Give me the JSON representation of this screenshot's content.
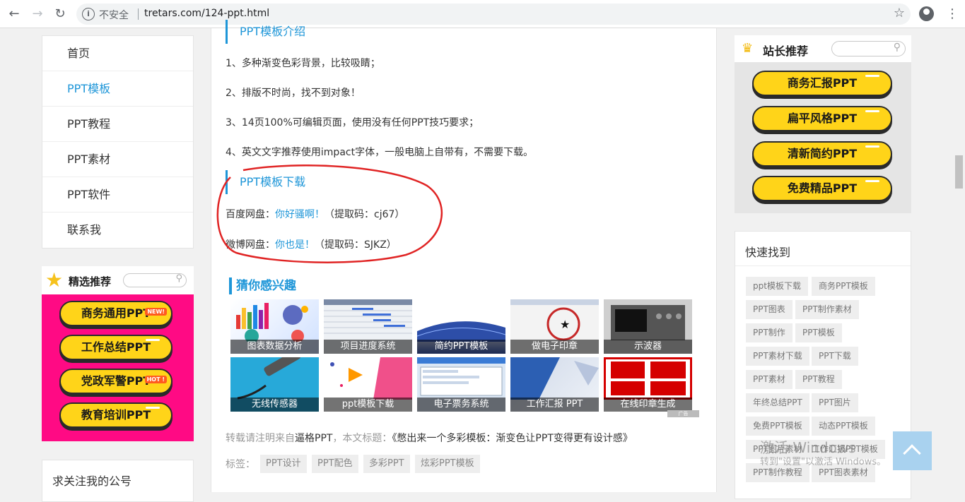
{
  "browser": {
    "insecure_label": "不安全",
    "url": "tretars.com/124-ppt.html"
  },
  "leftnav": {
    "items": [
      {
        "label": "首页"
      },
      {
        "label": "PPT模板"
      },
      {
        "label": "PPT教程"
      },
      {
        "label": "PPT素材"
      },
      {
        "label": "PPT软件"
      },
      {
        "label": "联系我"
      }
    ]
  },
  "featured": {
    "title": "精选推荐",
    "buttons": [
      {
        "label": "商务通用PPT",
        "tag": "NEW!"
      },
      {
        "label": "工作总结PPT",
        "tag": ""
      },
      {
        "label": "党政军警PPT",
        "tag": "HOT !"
      },
      {
        "label": "教育培训PPT",
        "tag": ""
      }
    ]
  },
  "qr": {
    "title": "求关注我的公号"
  },
  "article": {
    "intro_heading": "PPT模板介绍",
    "points": [
      "1、多种渐变色彩背景，比较吸睛；",
      "2、排版不时尚，找不到对象！",
      "3、14页100%可编辑页面，使用没有任何PPT技巧要求；",
      "4、英文文字推荐使用impact字体，一般电脑上自带有，不需要下载。"
    ],
    "download_heading": "PPT模板下载",
    "baidu": {
      "prefix": "百度网盘：",
      "link": "你好骚啊！",
      "code": "（提取码：cj67）"
    },
    "weibo": {
      "prefix": "微博网盘：",
      "link": "你也是！",
      "code": "（提取码：SJKZ）"
    },
    "guess_heading": "猜你感兴趣",
    "thumbs": [
      {
        "caption": "图表数据分析"
      },
      {
        "caption": "项目进度系统"
      },
      {
        "caption": "简约PPT模板"
      },
      {
        "caption": "做电子印章"
      },
      {
        "caption": "示波器"
      },
      {
        "caption": "无线传感器"
      },
      {
        "caption": "ppt模板下载"
      },
      {
        "caption": "电子票务系统"
      },
      {
        "caption": "工作汇报 PPT"
      },
      {
        "caption": "在线印章生成"
      }
    ],
    "ad_label": "广告",
    "repost_prefix": "转载请注明来自",
    "repost_site": "逼格PPT",
    "repost_mid": "，本文标题：",
    "repost_title": "《憋出来一个多彩模板：渐变色让PPT变得更有设计感》",
    "tags_label": "标签：",
    "tags": [
      "PPT设计",
      "PPT配色",
      "多彩PPT",
      "炫彩PPT模板"
    ]
  },
  "recommend": {
    "title": "站长推荐",
    "buttons": [
      {
        "label": "商务汇报PPT"
      },
      {
        "label": "扁平风格PPT"
      },
      {
        "label": "清新简约PPT"
      },
      {
        "label": "免费精品PPT"
      }
    ]
  },
  "quick": {
    "title": "快速找到",
    "chips": [
      "ppt模板下载",
      "商务PPT模板",
      "PPT图表",
      "PPT制作素材",
      "PPT制作",
      "PPT模板",
      "PPT素材下载",
      "PPT下载",
      "PPT素材",
      "PPT教程",
      "年终总结PPT",
      "PPT图片",
      "免费PPT模板",
      "动态PPT模板",
      "PPT图片素材",
      "工作汇报PPT模板",
      "PPT制作教程",
      "PPT图表素材"
    ]
  },
  "watermark": {
    "line1": "激活 Windows",
    "line2": "转到\"设置\"以激活 Windows。"
  },
  "colors": {
    "accent": "#1e96d8",
    "featured_bg": "#ff0a84",
    "button_yellow": "#ffd419"
  }
}
